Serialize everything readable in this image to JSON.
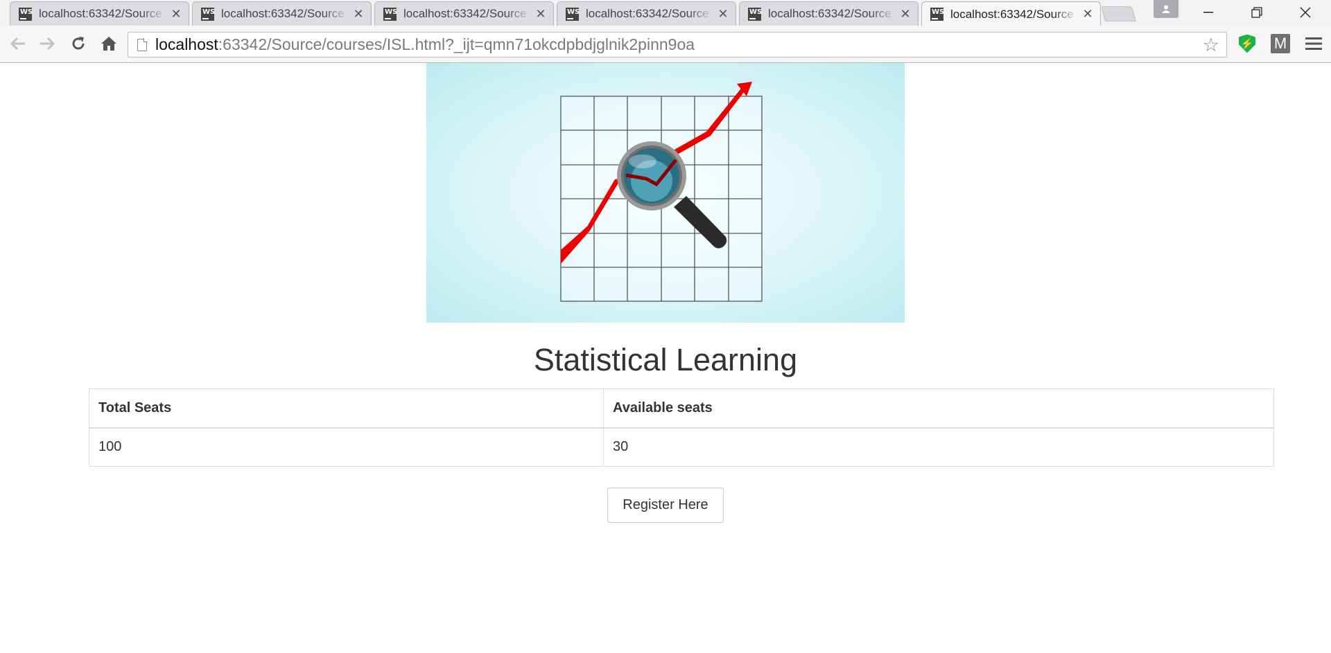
{
  "browser": {
    "tabs": [
      {
        "title": "localhost:63342/Source",
        "active": false
      },
      {
        "title": "localhost:63342/Source",
        "active": false
      },
      {
        "title": "localhost:63342/Source",
        "active": false
      },
      {
        "title": "localhost:63342/Source",
        "active": false
      },
      {
        "title": "localhost:63342/Source",
        "active": false
      },
      {
        "title": "localhost:63342/Source",
        "active": true
      }
    ],
    "tab_icon": "WS",
    "tab_close_glyph": "✕",
    "url_host": "localhost",
    "url_rest": ":63342/Source/courses/ISL.html?_ijt=qmn71okcdpbdjglnik2pinn9oa",
    "extensions": {
      "m_label": "M",
      "shield_glyph": "⚡"
    }
  },
  "page": {
    "title": "Statistical Learning",
    "table": {
      "headers": [
        "Total Seats",
        "Available seats"
      ],
      "rows": [
        [
          "100",
          "30"
        ]
      ]
    },
    "register_label": "Register Here"
  },
  "colors": {
    "hero_bg": "#c8eff3",
    "trend_line": "#ee0000",
    "accent_green": "#1fb24a"
  }
}
